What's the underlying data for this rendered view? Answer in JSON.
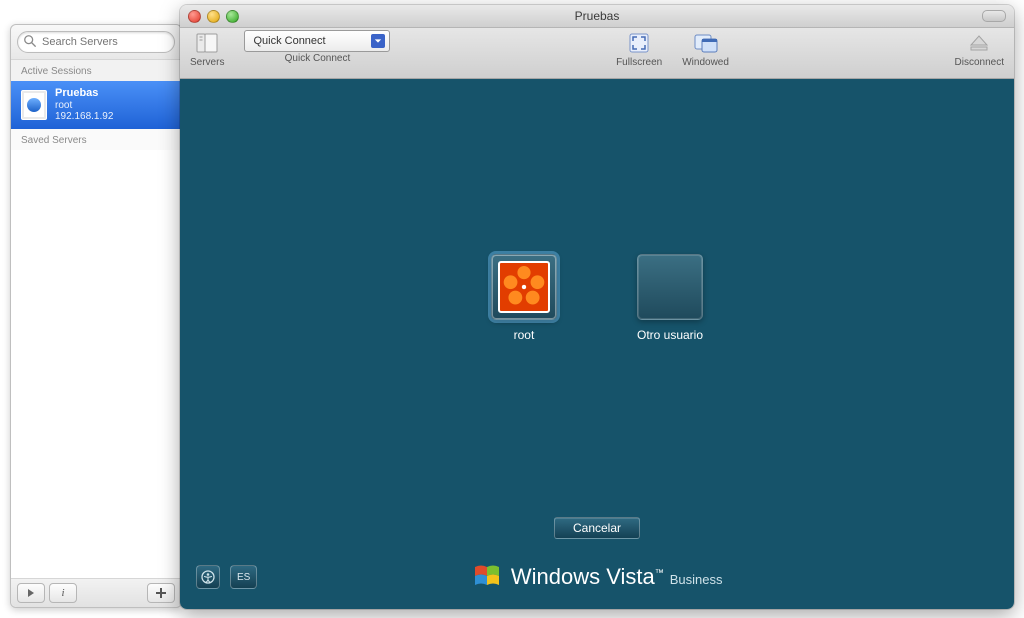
{
  "sidebar": {
    "search_placeholder": "Search Servers",
    "active_header": "Active Sessions",
    "saved_header": "Saved Servers",
    "sessions": [
      {
        "title": "Pruebas",
        "user": "root",
        "host": "192.168.1.92"
      }
    ]
  },
  "window": {
    "title": "Pruebas",
    "toolbar": {
      "servers": "Servers",
      "quick_connect_label": "Quick Connect",
      "quick_connect_value": "Quick Connect",
      "fullscreen": "Fullscreen",
      "windowed": "Windowed",
      "disconnect": "Disconnect"
    }
  },
  "vista": {
    "users": [
      {
        "label": "root"
      },
      {
        "label": "Otro usuario"
      }
    ],
    "cancel": "Cancelar",
    "language": "ES",
    "brand_main": "Windows Vista",
    "brand_edition": "Business"
  },
  "colors": {
    "desktop_bg": "#16536a"
  }
}
